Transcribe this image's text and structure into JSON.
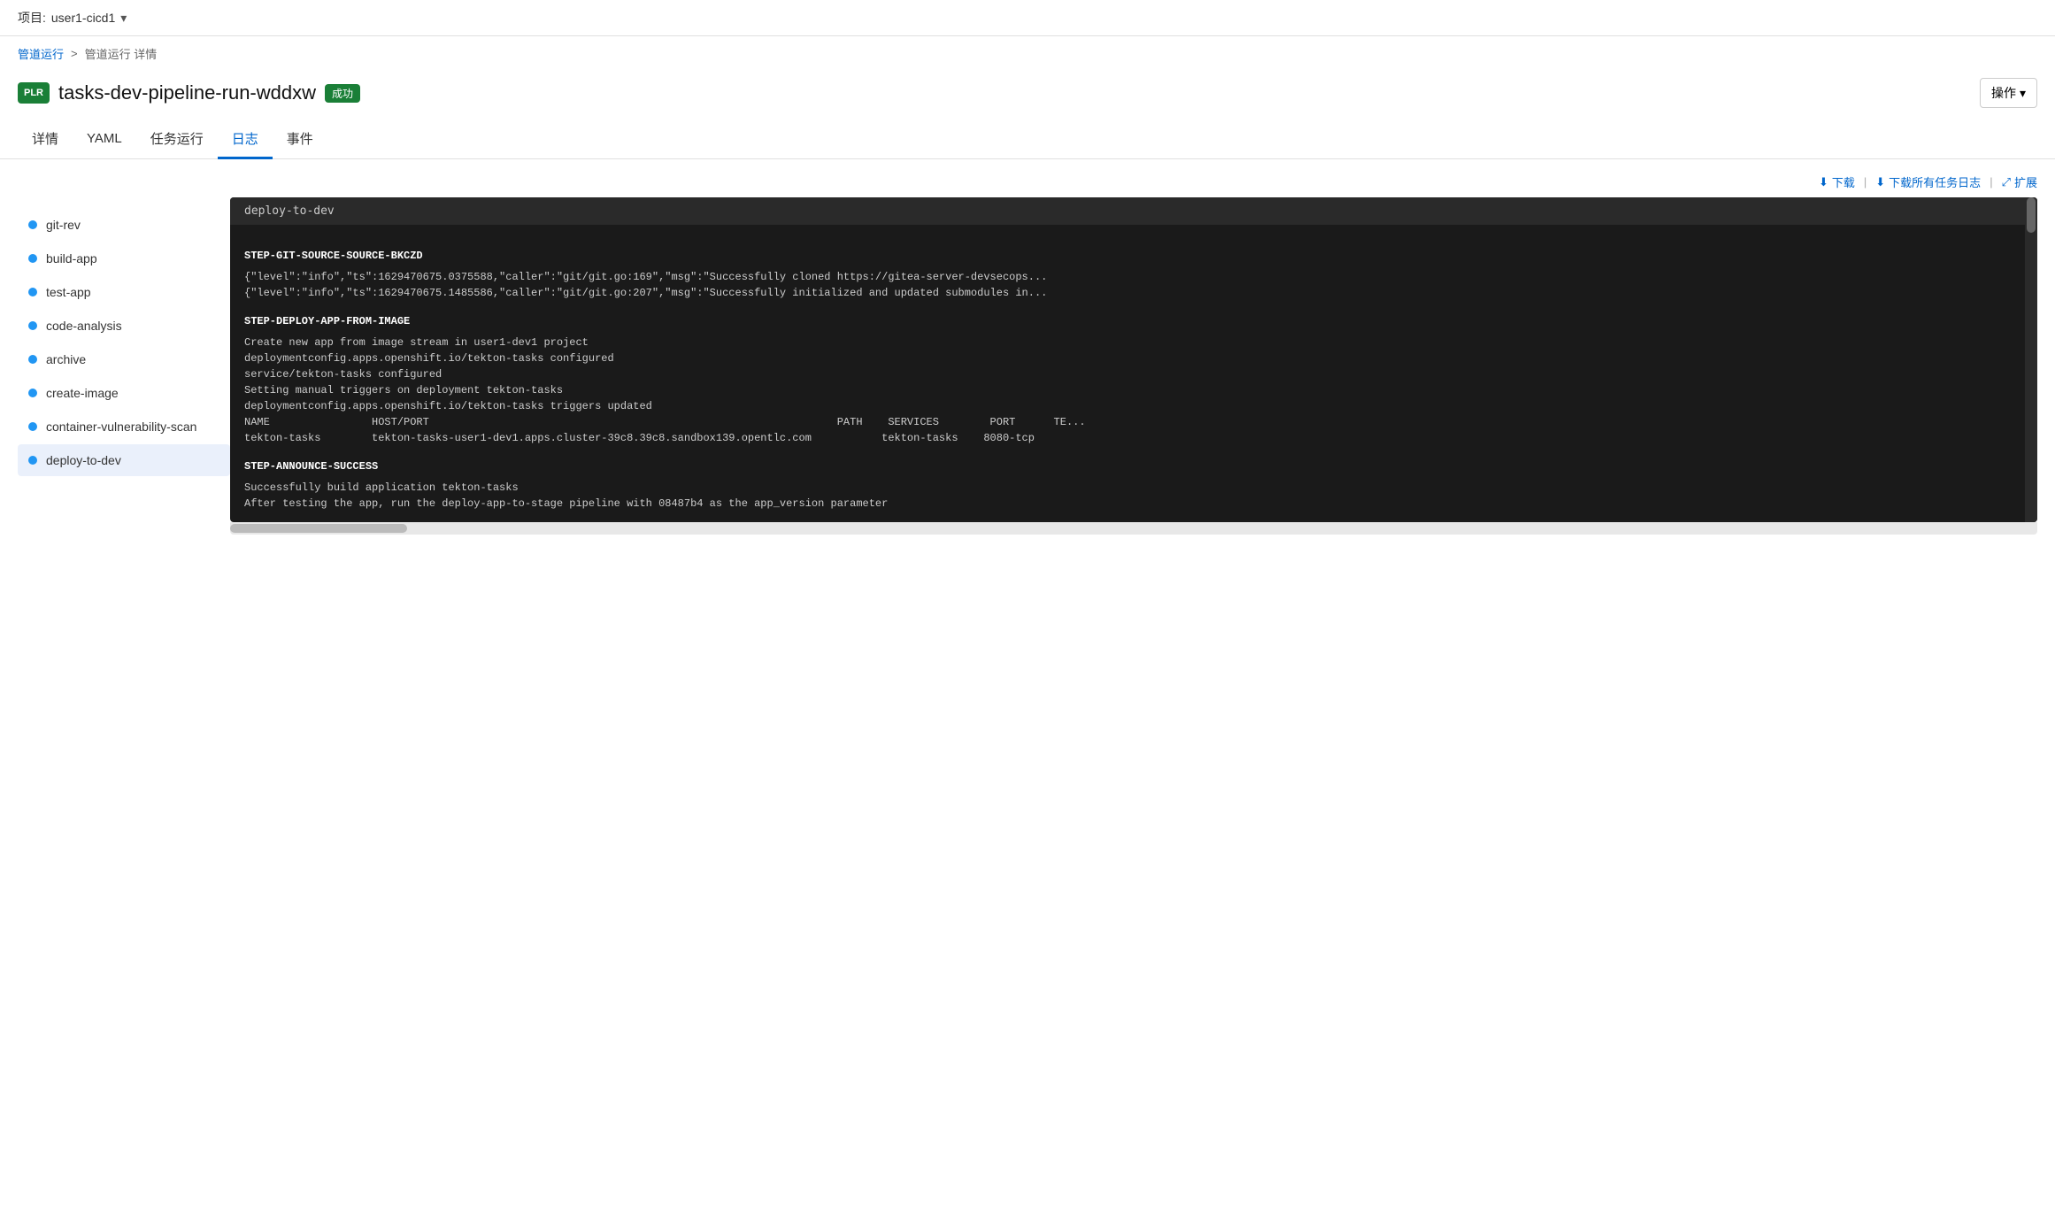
{
  "header": {
    "project_prefix": "项目:",
    "project_name": "user1-cicd1",
    "dropdown_icon": "▾"
  },
  "breadcrumb": {
    "parent": "管道运行",
    "separator": ">",
    "current": "管道运行 详情"
  },
  "title_row": {
    "badge": "PLR",
    "pipeline_run_name": "tasks-dev-pipeline-run-wddxw",
    "status": "成功",
    "actions_label": "操作",
    "actions_icon": "▾"
  },
  "tabs": [
    {
      "id": "details",
      "label": "详情"
    },
    {
      "id": "yaml",
      "label": "YAML"
    },
    {
      "id": "task-runs",
      "label": "任务运行"
    },
    {
      "id": "logs",
      "label": "日志",
      "active": true
    },
    {
      "id": "events",
      "label": "事件"
    }
  ],
  "log_toolbar": {
    "download_icon": "⬇",
    "download_label": "下载",
    "separator": "|",
    "download_all_icon": "⬇",
    "download_all_label": "下载所有任务日志",
    "sep2": "|",
    "expand_icon": "⤢",
    "expand_label": "扩展"
  },
  "log_panel": {
    "header": "deploy-to-dev",
    "sections": [
      {
        "id": "step-git-source",
        "header": "STEP-GIT-SOURCE-SOURCE-BKCZD",
        "lines": [
          "{\"level\":\"info\",\"ts\":1629470675.0375588,\"caller\":\"git/git.go:169\",\"msg\":\"Successfully cloned https://gitea-server-devsecops...",
          "{\"level\":\"info\",\"ts\":1629470675.1485586,\"caller\":\"git/git.go:207\",\"msg\":\"Successfully initialized and updated submodules in..."
        ]
      },
      {
        "id": "step-deploy-app",
        "header": "STEP-DEPLOY-APP-FROM-IMAGE",
        "lines": [
          "Create new app from image stream in user1-dev1 project",
          "deploymentconfig.apps.openshift.io/tekton-tasks configured",
          "service/tekton-tasks configured",
          "Setting manual triggers on deployment tekton-tasks",
          "deploymentconfig.apps.openshift.io/tekton-tasks triggers updated"
        ],
        "table": {
          "header": "NAME                HOST/PORT                                                                PATH    SERVICES        PORT      TE...",
          "row": "tekton-tasks        tekton-tasks-user1-dev1.apps.cluster-39c8.39c8.sandbox139.opentlc.com           tekton-tasks    8080-tcp"
        }
      },
      {
        "id": "step-announce-success",
        "header": "STEP-ANNOUNCE-SUCCESS",
        "lines": [
          "Successfully build application tekton-tasks",
          "After testing the app, run the deploy-app-to-stage pipeline with 08487b4 as the app_version parameter"
        ]
      }
    ]
  },
  "sidebar_items": [
    {
      "id": "git-rev",
      "label": "git-rev",
      "active": false
    },
    {
      "id": "build-app",
      "label": "build-app",
      "active": false
    },
    {
      "id": "test-app",
      "label": "test-app",
      "active": false
    },
    {
      "id": "code-analysis",
      "label": "code-analysis",
      "active": false
    },
    {
      "id": "archive",
      "label": "archive",
      "active": false
    },
    {
      "id": "create-image",
      "label": "create-image",
      "active": false
    },
    {
      "id": "container-vulnerability-scan",
      "label": "container-vulnerability-scan",
      "active": false
    },
    {
      "id": "deploy-to-dev",
      "label": "deploy-to-dev",
      "active": true
    }
  ]
}
